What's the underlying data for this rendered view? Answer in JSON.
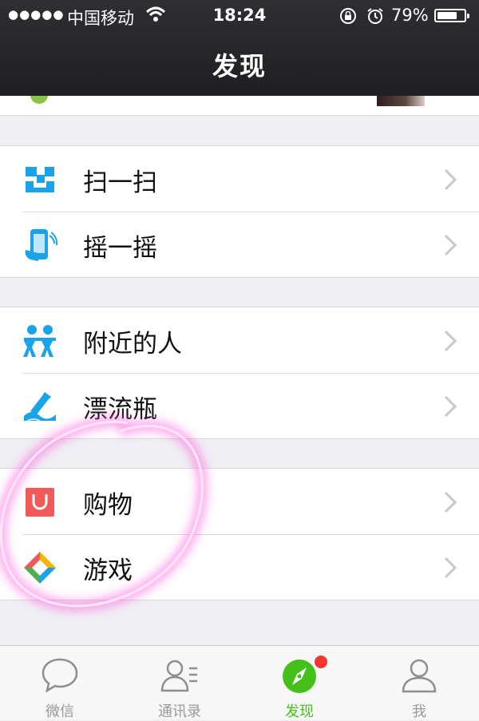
{
  "status_bar": {
    "signal": "●●●●●",
    "carrier": "中国移动",
    "time": "18:24",
    "battery_percent": "79%",
    "battery_level": 0.79,
    "icons": [
      "wifi-icon",
      "rotation-lock-icon",
      "alarm-icon",
      "battery-icon"
    ]
  },
  "nav": {
    "title": "发现"
  },
  "groups": [
    {
      "items": [
        {
          "label": "扫一扫",
          "icon": "scan-icon"
        },
        {
          "label": "摇一摇",
          "icon": "shake-icon"
        }
      ]
    },
    {
      "items": [
        {
          "label": "附近的人",
          "icon": "people-nearby-icon"
        },
        {
          "label": "漂流瓶",
          "icon": "drift-bottle-icon"
        }
      ]
    },
    {
      "items": [
        {
          "label": "购物",
          "icon": "shopping-bag-icon"
        },
        {
          "label": "游戏",
          "icon": "games-icon"
        }
      ]
    }
  ],
  "tabbar": {
    "tabs": [
      {
        "label": "微信",
        "icon": "chat-bubble-icon",
        "active": false
      },
      {
        "label": "通讯录",
        "icon": "contacts-icon",
        "active": false
      },
      {
        "label": "发现",
        "icon": "compass-icon",
        "active": true,
        "badge": true
      },
      {
        "label": "我",
        "icon": "person-icon",
        "active": false
      }
    ]
  },
  "colors": {
    "active_green": "#45c01a",
    "icon_blue": "#1aa3e8",
    "shopping_red": "#f25a5a",
    "badge_red": "#f43530",
    "highlight_pink": "#ff4fd8"
  }
}
